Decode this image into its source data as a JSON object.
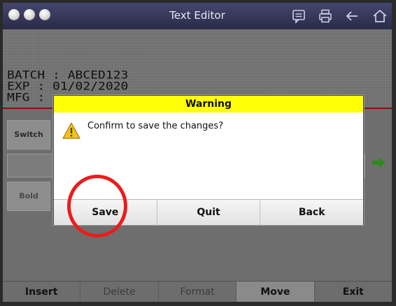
{
  "window": {
    "title": "Text Editor"
  },
  "editor": {
    "lines": [
      "BATCH : ABCED123",
      "EXP : 01/02/2020",
      "MFG :"
    ]
  },
  "controls": {
    "switch_label": "Switch",
    "bold_label": "Bold"
  },
  "dialog": {
    "title": "Warning",
    "message": "Confirm to save the changes?",
    "buttons": {
      "save": "Save",
      "quit": "Quit",
      "back": "Back"
    }
  },
  "toolbar": {
    "insert": "Insert",
    "delete": "Delete",
    "format": "Format",
    "move": "Move",
    "exit": "Exit"
  },
  "colors": {
    "warning_header": "#ffff05",
    "highlight_ring": "#ec1c1c",
    "titlebar": "#2e2f4e"
  },
  "icons": [
    "window-dot-icon",
    "message-icon",
    "printer-icon",
    "back-arrow-icon",
    "home-icon",
    "warning-icon",
    "green-arrow-icon"
  ]
}
